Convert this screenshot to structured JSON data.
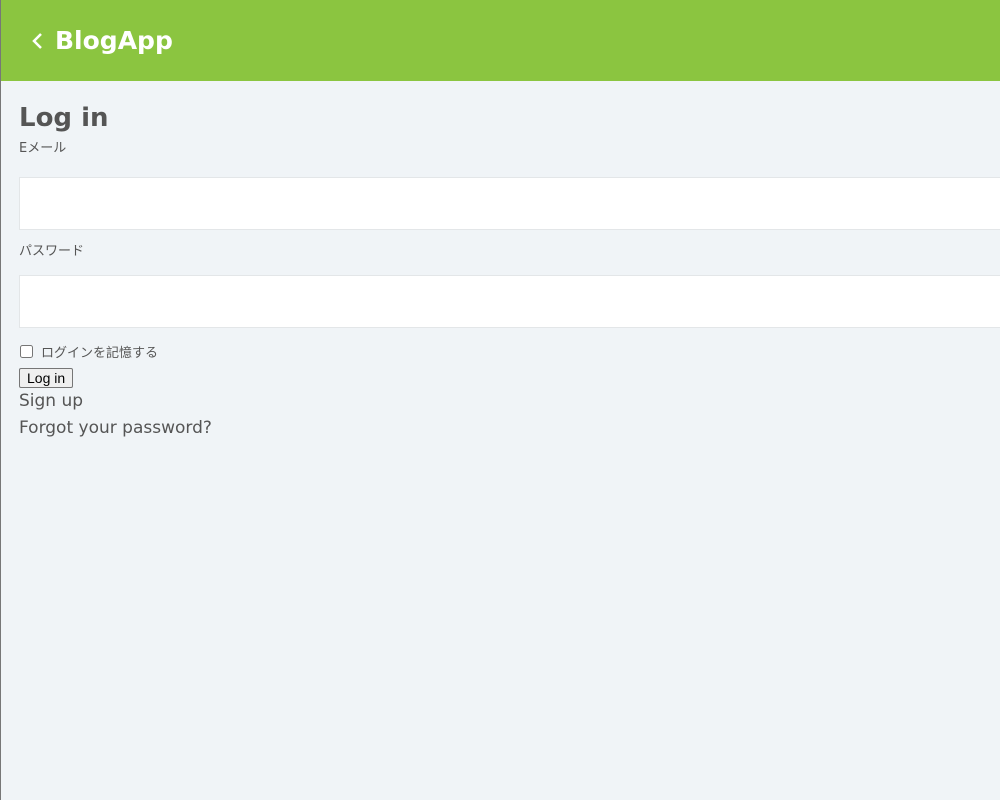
{
  "header": {
    "title": "BlogApp",
    "back_icon": "chevron-left-icon"
  },
  "main": {
    "heading": "Log in",
    "email_label": "Eメール",
    "email_value": "",
    "password_label": "パスワード",
    "password_value": "",
    "remember_label": "ログインを記憶する",
    "remember_checked": false,
    "login_button": "Log in",
    "signup_link": "Sign up",
    "forgot_link": "Forgot your password?"
  },
  "colors": {
    "header": "#8bc540",
    "background": "#f0f4f7",
    "text": "#555555"
  }
}
